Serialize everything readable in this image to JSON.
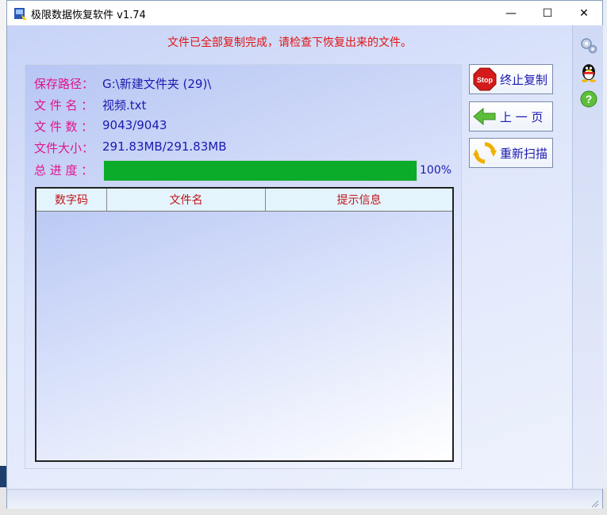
{
  "window": {
    "title": "极限数据恢复软件 v1.74",
    "min_glyph": "—",
    "max_glyph": "☐",
    "close_glyph": "✕"
  },
  "status_message": "文件已全部复制完成，请检查下恢复出来的文件。",
  "info": {
    "save_path_label": "保存路径：",
    "save_path_value": "G:\\新建文件夹 (29)\\",
    "file_name_label": "文 件 名 ：",
    "file_name_value": "视频.txt",
    "file_count_label": "文 件 数 ：",
    "file_count_value": "9043/9043",
    "file_size_label": "文件大小：",
    "file_size_value": "291.83MB/291.83MB",
    "progress_label": "总 进 度 ：",
    "progress_percent_text": "100%",
    "progress_fraction": 1.0
  },
  "table": {
    "columns": [
      "数字码",
      "文件名",
      "提示信息"
    ],
    "rows": []
  },
  "buttons": {
    "stop_label": "终止复制",
    "stop_icon_text": "Stop",
    "prev_label": "上 一 页",
    "rescan_label": "重新扫描"
  },
  "side_icons": [
    "settings-gear-icon",
    "qq-penguin-icon",
    "help-question-icon"
  ],
  "colors": {
    "status_red": "#e01414",
    "label_magenta": "#e0148c",
    "value_blue": "#1a1ab0",
    "progress_green": "#0aac2a",
    "header_red": "#c0141a"
  }
}
